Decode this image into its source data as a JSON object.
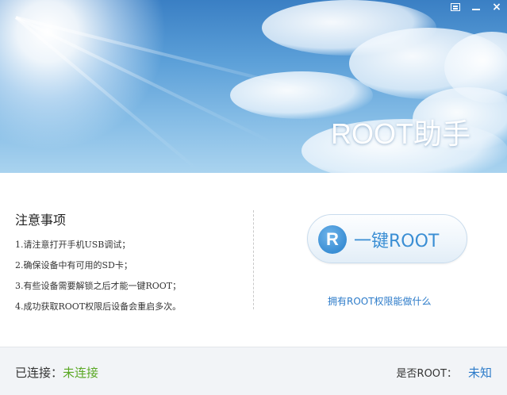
{
  "window": {
    "controls": [
      "feedback-icon",
      "minimize-icon",
      "close-icon"
    ],
    "close_glyph": "×"
  },
  "banner": {
    "title": "ROOT助手"
  },
  "notes": {
    "title": "注意事项",
    "items": [
      "1.请注意打开手机USB调试；",
      "2.确保设备中有可用的SD卡；",
      "3.有些设备需要解锁之后才能一键ROOT；",
      "4.成功获取ROOT权限后设备会重启多次。"
    ]
  },
  "action": {
    "logo_letter": "R",
    "button_label": "一键ROOT",
    "link": "拥有ROOT权限能做什么"
  },
  "status": {
    "connected_label": "已连接：",
    "connected_value": "未连接",
    "root_label": "是否ROOT：",
    "root_value": "未知"
  },
  "colors": {
    "accent": "#3a8ed4",
    "link": "#2c7bc9",
    "status_green": "#5aa824"
  }
}
